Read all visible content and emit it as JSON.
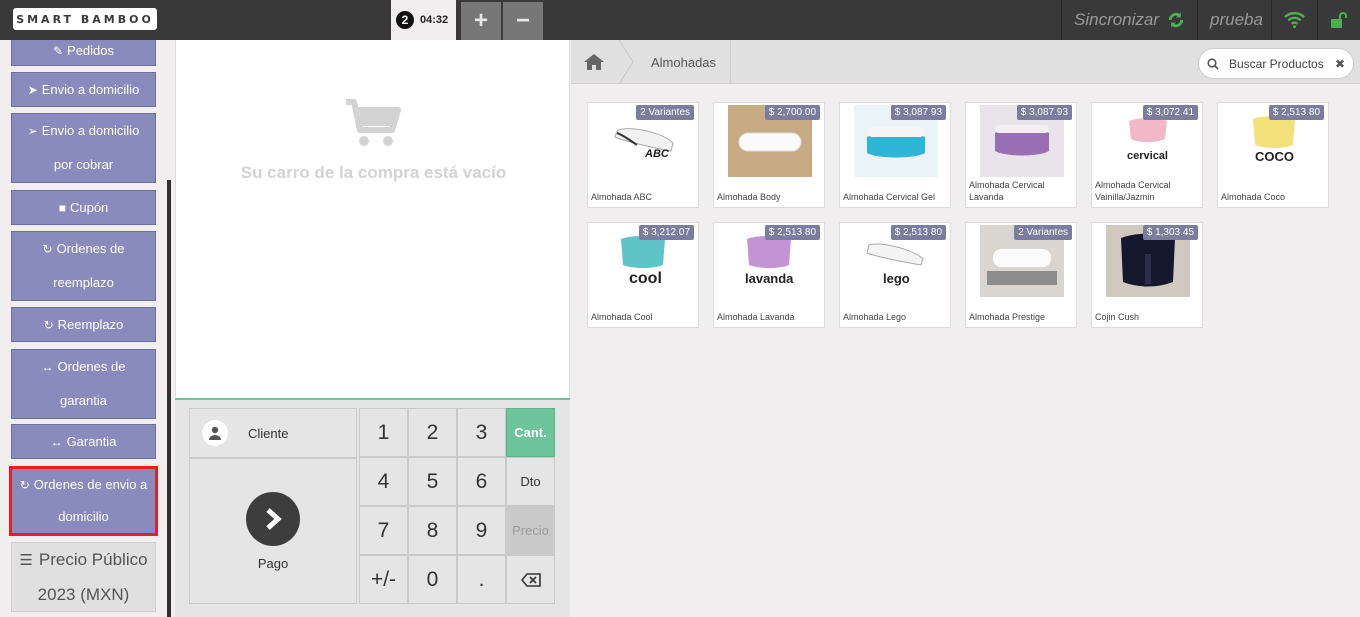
{
  "app": {
    "logo_text": "SMART BAMBOO"
  },
  "top": {
    "order_number": "2",
    "order_time": "04:32",
    "add_label": "+",
    "remove_label": "−",
    "sync_label": "Sincronizar",
    "user_label": "prueba"
  },
  "sidebar": {
    "pedidos": "Pedidos",
    "envio": "Envio a domicilio",
    "envio_cobrar_1": "Envio a domicilio",
    "envio_cobrar_2": "por cobrar",
    "cupon": "Cupón",
    "ordenes_reemplazo_1": "Ordenes de",
    "ordenes_reemplazo_2": "reemplazo",
    "reemplazo": "Reemplazo",
    "ordenes_garantia_1": "Ordenes de",
    "ordenes_garantia_2": "garantia",
    "garantia": "Garantia",
    "ordenes_envio_1": "Ordenes de envio a",
    "ordenes_envio_2": "domicilio",
    "price_list_1": "Precio Público",
    "price_list_2": "2023 (MXN)"
  },
  "cart": {
    "empty_text": "Su carro de la compra está vacío",
    "cliente": "Cliente",
    "pago": "Pago"
  },
  "numpad": {
    "k1": "1",
    "k2": "2",
    "k3": "3",
    "cant": "Cant.",
    "k4": "4",
    "k5": "5",
    "k6": "6",
    "dto": "Dto",
    "k7": "7",
    "k8": "8",
    "k9": "9",
    "precio": "Precio",
    "sign": "+/-",
    "k0": "0",
    "dot": "."
  },
  "products": {
    "breadcrumb": "Almohadas",
    "search_placeholder": "Buscar Productos",
    "items": [
      {
        "name": "Almohada ABC",
        "badge": "2 Variantes",
        "logo": "ABC"
      },
      {
        "name": "Almohada Body",
        "badge": "$ 2,700.00"
      },
      {
        "name": "Almohada Cervical Gel",
        "badge": "$ 3,087.93"
      },
      {
        "name": "Almohada Cervical Lavanda",
        "badge": "$ 3,087.93"
      },
      {
        "name": "Almohada Cervical Vainilla/Jazmin",
        "badge": "$ 3,072.41",
        "logo": "cervical"
      },
      {
        "name": "Almohada Coco",
        "badge": "$ 2,513.80",
        "logo": "COCO"
      },
      {
        "name": "Almohada Cool",
        "badge": "$ 3,212.07",
        "logo": "cool"
      },
      {
        "name": "Almohada Lavanda",
        "badge": "$ 2,513.80",
        "logo": "lavanda"
      },
      {
        "name": "Almohada Lego",
        "badge": "$ 2,513.80",
        "logo": "lego"
      },
      {
        "name": "Almohada Prestige",
        "badge": "2 Variantes"
      },
      {
        "name": "Cojin Cush",
        "badge": "$ 1,303.45"
      }
    ]
  },
  "colors": {
    "topbar": "#393939",
    "sidebar_button": "#8a8bbd",
    "selected_outline": "#e81e23",
    "numpad_active": "#6ec49b",
    "badge": "#7b7c9e",
    "sync_green": "#4caf50"
  }
}
